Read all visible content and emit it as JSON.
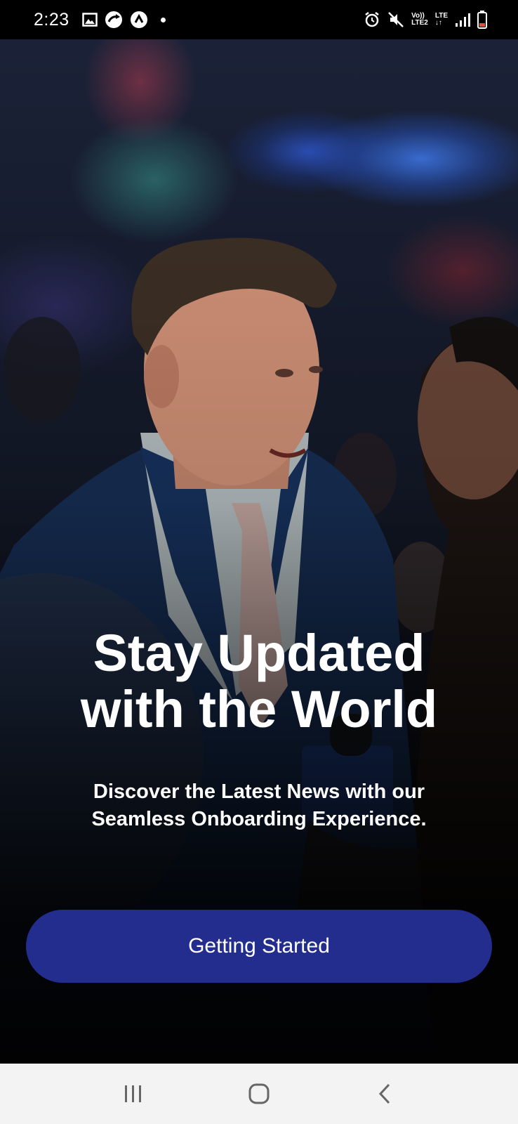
{
  "status_bar": {
    "time": "2:23",
    "left_icons": [
      "gallery-icon",
      "sync-icon",
      "navigation-icon",
      "notification-dot"
    ],
    "right_icons": [
      "alarm-icon",
      "mute-icon",
      "volte-icon",
      "lte-icon",
      "signal-icon",
      "battery-icon"
    ],
    "volte_label": "Vo))",
    "volte_sub": "LTE2",
    "lte_label": "LTE",
    "lte_arrows": "↓↑"
  },
  "hero": {
    "image": "news-reporter-photo",
    "title_line1": "Stay Updated",
    "title_line2": "with the World",
    "subtitle_line1": "Discover the Latest News with our",
    "subtitle_line2": "Seamless Onboarding Experience."
  },
  "cta": {
    "label": "Getting Started",
    "color": "#232d8e"
  },
  "nav_bar": {
    "buttons": [
      "recents-icon",
      "home-icon",
      "back-icon"
    ]
  }
}
